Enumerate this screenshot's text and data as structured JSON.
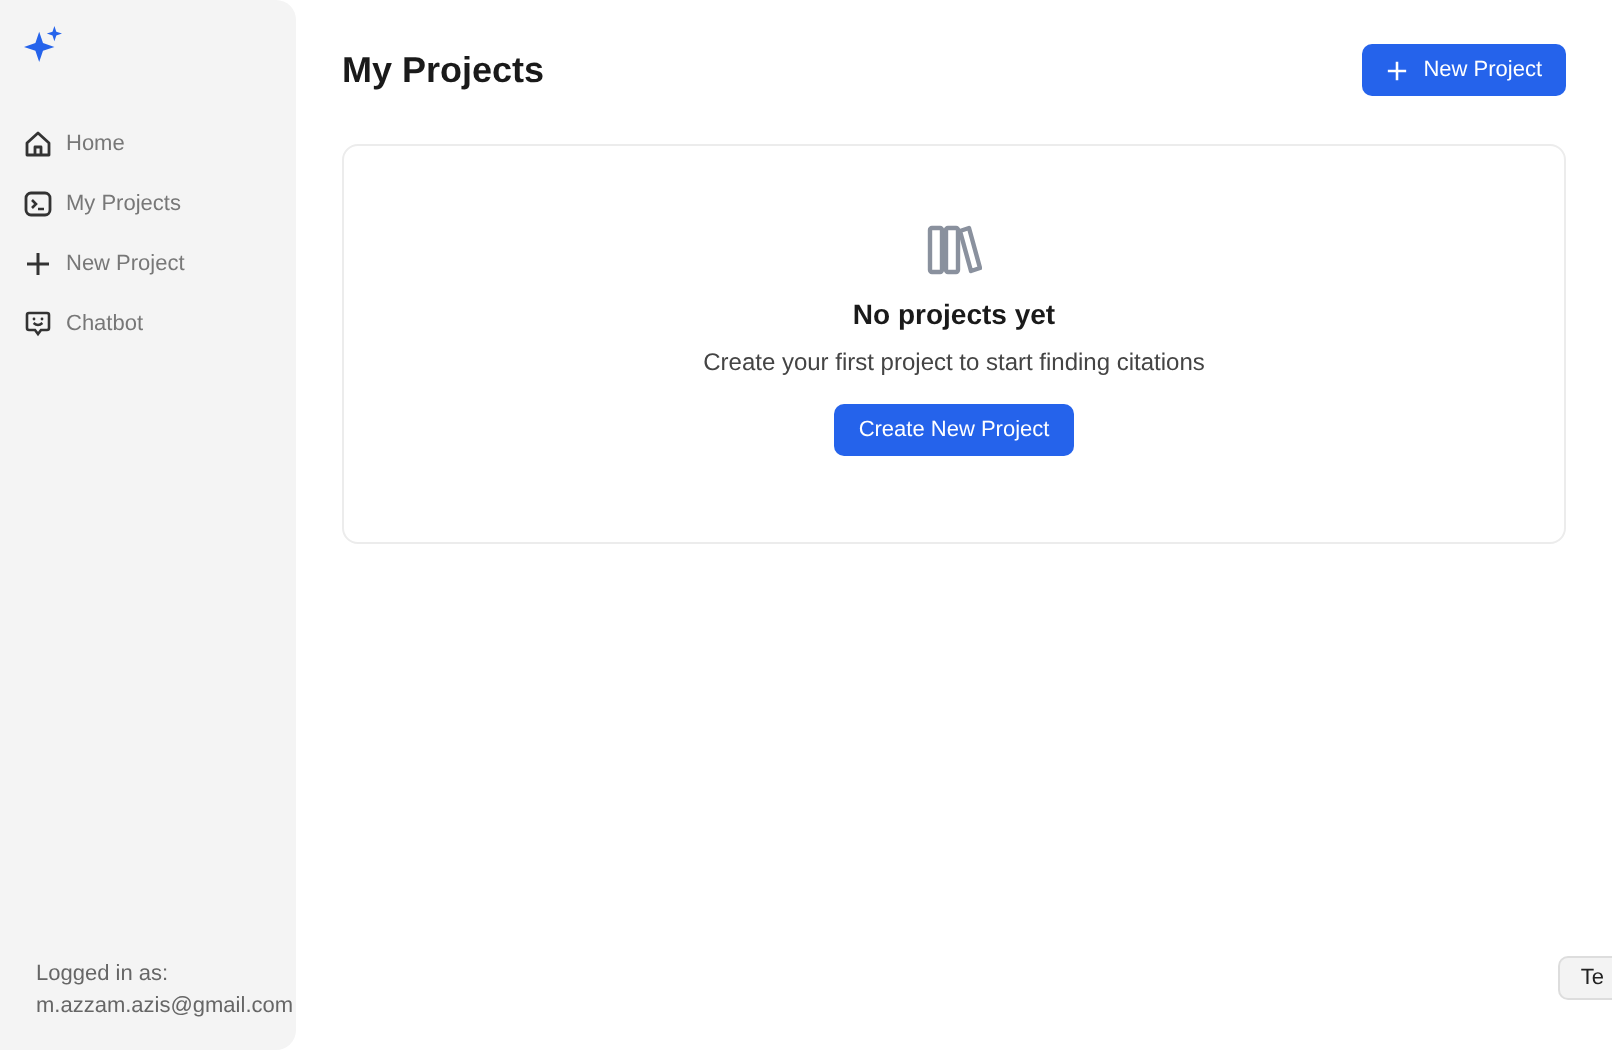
{
  "sidebar": {
    "items": [
      {
        "label": "Home",
        "kind": "home"
      },
      {
        "label": "My Projects",
        "kind": "projects"
      },
      {
        "label": "New Project",
        "kind": "new"
      },
      {
        "label": "Chatbot",
        "kind": "chat"
      }
    ],
    "user": {
      "label": "Logged in as:",
      "email": "m.azzam.azis@gmail.com"
    }
  },
  "page": {
    "title": "My Projects",
    "new_button": "New Project"
  },
  "empty_state": {
    "title": "No projects yet",
    "message": "Create your first project to start finding citations",
    "button": "Create New Project"
  },
  "floating_button": "Te"
}
